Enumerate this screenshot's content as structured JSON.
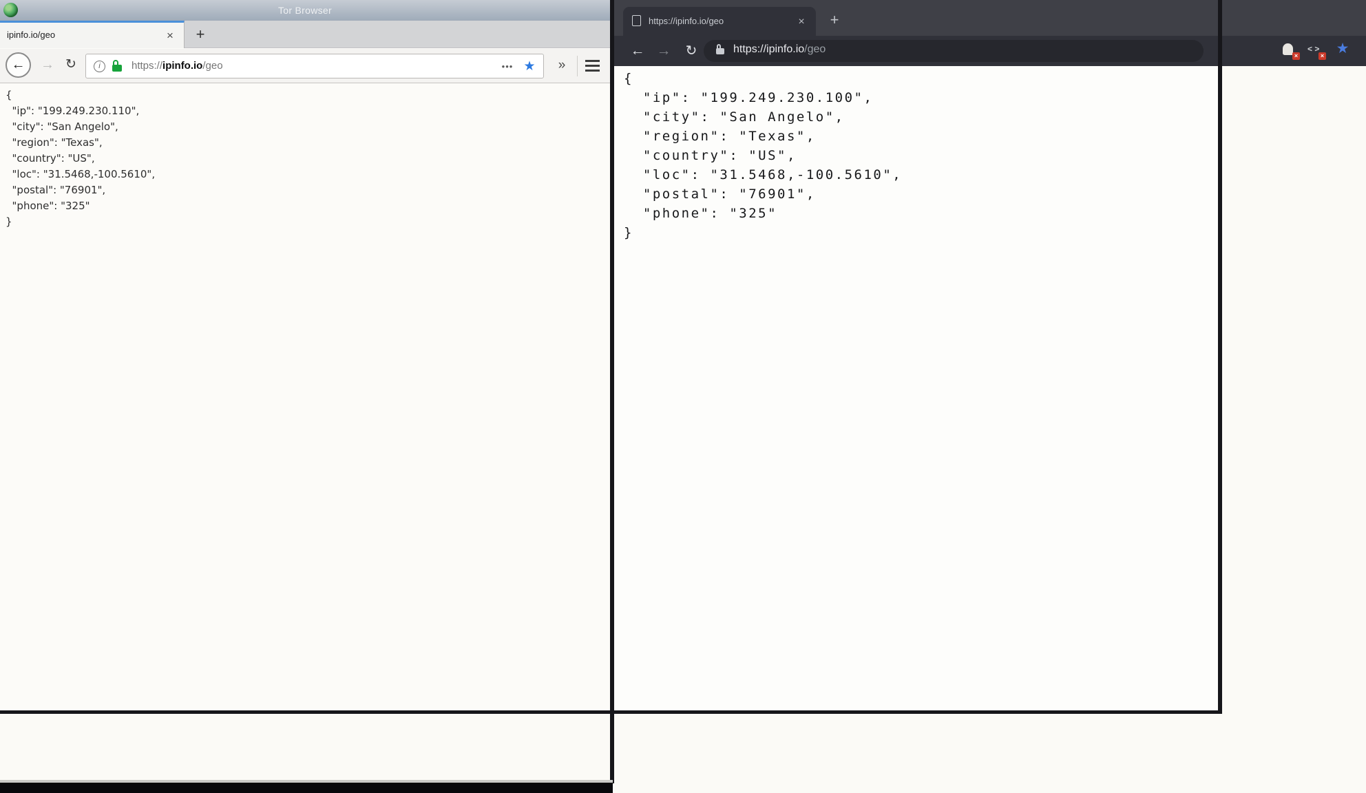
{
  "left_browser": {
    "window_title": "Tor Browser",
    "tab_title": "ipinfo.io/geo",
    "close_glyph": "×",
    "new_tab_glyph": "+",
    "back_glyph": "←",
    "forward_glyph": "→",
    "reload_glyph": "↻",
    "info_glyph": "i",
    "url_scheme": "https://",
    "url_host": "ipinfo.io",
    "url_path": "/geo",
    "page_actions_glyph": "•••",
    "bookmark_star_glyph": "★",
    "overflow_glyph": "»",
    "json_text": "{\n  \"ip\": \"199.249.230.110\",\n  \"city\": \"San Angelo\",\n  \"region\": \"Texas\",\n  \"country\": \"US\",\n  \"loc\": \"31.5468,-100.5610\",\n  \"postal\": \"76901\",\n  \"phone\": \"325\"\n}"
  },
  "right_browser": {
    "tab_title": "https://ipinfo.io/geo",
    "close_glyph": "×",
    "new_tab_glyph": "+",
    "back_glyph": "←",
    "forward_glyph": "→",
    "reload_glyph": "↻",
    "url_main": "https://ipinfo.io",
    "url_path": "/geo",
    "json_text": "{\n  \"ip\": \"199.249.230.100\",\n  \"city\": \"San Angelo\",\n  \"region\": \"Texas\",\n  \"country\": \"US\",\n  \"loc\": \"31.5468,-100.5610\",\n  \"postal\": \"76901\",\n  \"phone\": \"325\"\n}"
  },
  "background_browser": {
    "code_icon_glyph": "< >",
    "ghost_badge_glyph": "×",
    "code_badge_glyph": "×",
    "bookmark_star_glyph": "★"
  },
  "colors": {
    "firefox_active_tab_accent": "#4a90d9",
    "firefox_lock_green": "#17a33b",
    "firefox_star_blue": "#2d7ae0",
    "chrome_dark_tabbar": "#3f4047",
    "chrome_dark_toolbar": "#303139",
    "chrome_star_blue": "#4a7cdf",
    "extension_badge_red": "#cc3a2a",
    "window_border_black": "#16161a"
  }
}
